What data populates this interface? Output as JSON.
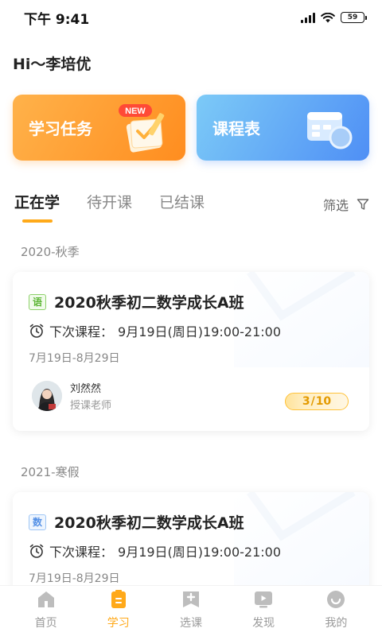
{
  "status": {
    "time": "下午 9:41",
    "battery": "59"
  },
  "greeting": "Hi～李培优",
  "actions": [
    {
      "label": "学习任务",
      "badge": "NEW",
      "icon": "notebook-pencil-icon"
    },
    {
      "label": "课程表",
      "icon": "calendar-clock-icon"
    }
  ],
  "tabs": [
    {
      "label": "正在学",
      "active": true
    },
    {
      "label": "待开课",
      "active": false
    },
    {
      "label": "已结课",
      "active": false
    }
  ],
  "filter": {
    "label": "筛选",
    "icon": "filter-icon"
  },
  "sections": [
    {
      "season": "2020-秋季",
      "course": {
        "subject": "语",
        "title": "2020秋季初二数学成长A班",
        "next_lesson_label": "下次课程：",
        "next_lesson_time": "9月19日(周日)19:00-21:00",
        "date_range": "7月19日-8月29日",
        "teacher_name": "刘然然",
        "teacher_role": "授课老师",
        "progress_done": 3,
        "progress_total": 10
      }
    },
    {
      "season": "2021-寒假",
      "course": {
        "subject": "数",
        "title": "2020秋季初二数学成长A班",
        "next_lesson_label": "下次课程：",
        "next_lesson_time": "9月19日(周日)19:00-21:00",
        "date_range": "7月19日-8月29日"
      }
    }
  ],
  "nav": [
    {
      "label": "首页",
      "icon": "home-icon",
      "active": false
    },
    {
      "label": "学习",
      "icon": "study-icon",
      "active": true
    },
    {
      "label": "选课",
      "icon": "course-select-icon",
      "active": false
    },
    {
      "label": "发现",
      "icon": "discover-icon",
      "active": false
    },
    {
      "label": "我的",
      "icon": "profile-icon",
      "active": false
    }
  ],
  "colors": {
    "accent": "#ffa91a",
    "orange_card": "#ff9a2a",
    "blue_card": "#5b9cf6"
  }
}
